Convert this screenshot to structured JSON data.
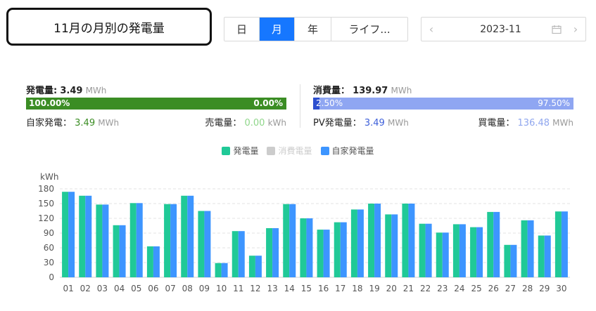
{
  "title": "11月の月別の発電量",
  "period_tabs": [
    {
      "label": "日",
      "active": false
    },
    {
      "label": "月",
      "active": true
    },
    {
      "label": "年",
      "active": false
    },
    {
      "label": "ライフ...",
      "active": false
    }
  ],
  "date_picker": {
    "value": "2023-11",
    "prev_icon": "chevron-left-icon",
    "next_icon": "chevron-right-icon",
    "calendar_icon": "calendar-icon"
  },
  "generation": {
    "label": "発電量:",
    "value": "3.49",
    "unit": "MWh",
    "bar_left_pct": "100.00%",
    "bar_right_pct": "0.00%",
    "bar_fill_fraction": 1.0,
    "self_label": "自家発電：",
    "self_value": "3.49",
    "self_unit": "MWh",
    "sold_label": "売電量：",
    "sold_value": "0.00",
    "sold_unit": "kWh",
    "colors": {
      "primary": "#3b8d24",
      "secondary": "#8fd68a"
    }
  },
  "consumption": {
    "label": "消費量：",
    "value": "139.97",
    "unit": "MWh",
    "bar_left_pct": "2.50%",
    "bar_right_pct": "97.50%",
    "bar_fill_fraction": 0.025,
    "pv_label": "PV発電量：",
    "pv_value": "3.49",
    "pv_unit": "MWh",
    "buy_label": "買電量：",
    "buy_value": "136.48",
    "buy_unit": "MWh",
    "colors": {
      "primary": "#2d4fcf",
      "secondary": "#8fa6f2"
    }
  },
  "chart_data": {
    "type": "bar",
    "ylabel": "kWh",
    "ylim": [
      0,
      180
    ],
    "yticks": [
      0,
      30,
      60,
      90,
      120,
      150,
      180
    ],
    "grid": true,
    "legend_position": "top-center",
    "categories": [
      "01",
      "02",
      "03",
      "04",
      "05",
      "06",
      "07",
      "08",
      "09",
      "10",
      "11",
      "12",
      "13",
      "14",
      "15",
      "16",
      "17",
      "18",
      "19",
      "20",
      "21",
      "22",
      "23",
      "24",
      "25",
      "26",
      "27",
      "28",
      "29",
      "30"
    ],
    "series": [
      {
        "name": "発電量",
        "color": "#20c997",
        "enabled": true,
        "values": [
          174,
          166,
          148,
          106,
          151,
          63,
          149,
          166,
          135,
          29,
          94,
          44,
          100,
          149,
          120,
          97,
          112,
          138,
          150,
          128,
          150,
          109,
          91,
          108,
          102,
          133,
          66,
          116,
          85,
          134
        ]
      },
      {
        "name": "消費電量",
        "color": "#cccccc",
        "enabled": false,
        "values": []
      },
      {
        "name": "自家発電量",
        "color": "#3d95ff",
        "enabled": true,
        "values": [
          174,
          166,
          148,
          106,
          151,
          63,
          149,
          166,
          135,
          29,
          94,
          44,
          100,
          149,
          120,
          97,
          112,
          138,
          150,
          128,
          150,
          109,
          91,
          108,
          102,
          133,
          66,
          116,
          85,
          134
        ]
      }
    ]
  }
}
